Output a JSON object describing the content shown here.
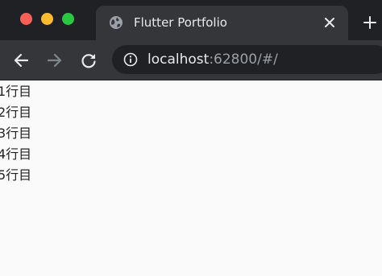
{
  "browser": {
    "tab": {
      "title": "Flutter Portfolio",
      "favicon": "globe-icon"
    },
    "new_tab_icon": "plus-icon",
    "toolbar": {
      "back_icon": "arrow-left-icon",
      "forward_icon": "arrow-right-icon",
      "reload_icon": "reload-icon",
      "info_icon": "info-icon"
    },
    "address": {
      "host": "localhost",
      "rest": ":62800/#/"
    }
  },
  "page": {
    "lines": [
      "1行目",
      "2行目",
      "3行目",
      "4行目",
      "5行目"
    ]
  },
  "colors": {
    "tab_bar_bg": "#202124",
    "active_tab_bg": "#35363a",
    "omnibox_bg": "#202124",
    "page_bg": "#fafafa",
    "traffic_close": "#ff5f57",
    "traffic_minimize": "#febc2e",
    "traffic_zoom": "#28c840"
  }
}
